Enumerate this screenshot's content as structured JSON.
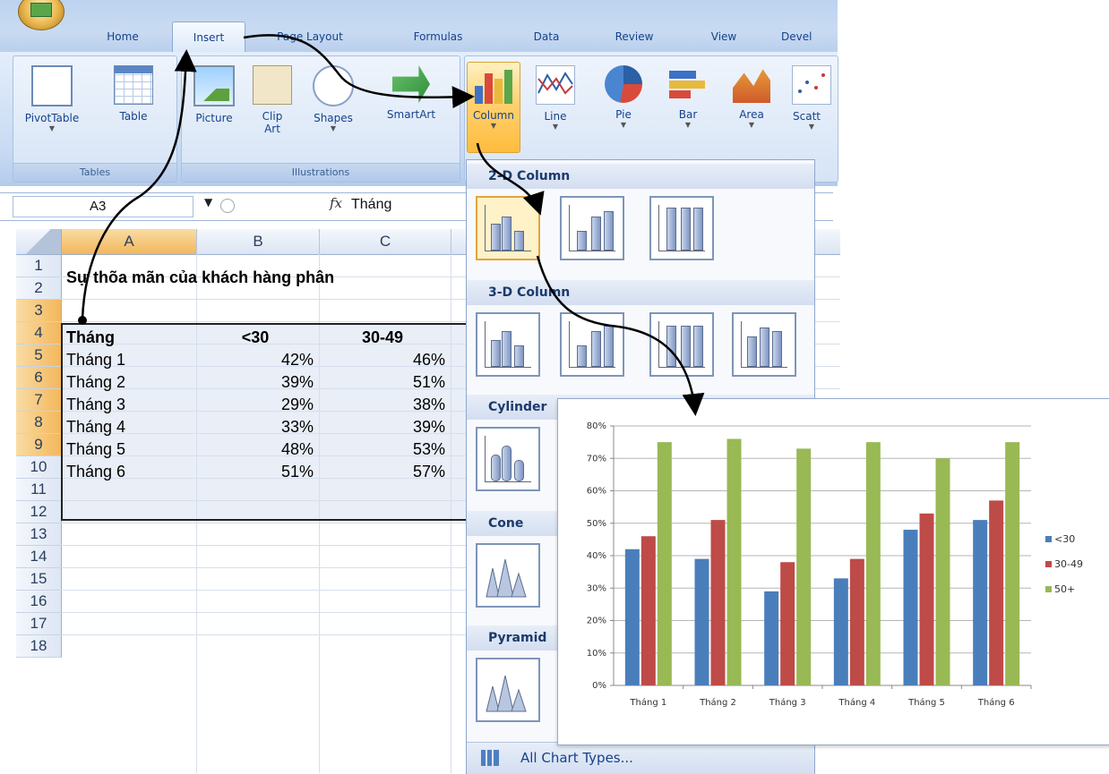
{
  "ribbon": {
    "tabs": [
      "Home",
      "Insert",
      "Page Layout",
      "Formulas",
      "Data",
      "Review",
      "View",
      "Devel"
    ],
    "active_tab": "Insert",
    "groups": {
      "tables": "Tables",
      "illustrations": "Illustrations"
    },
    "buttons": {
      "pivottable": "PivotTable",
      "table": "Table",
      "picture": "Picture",
      "clip_art": "Clip\nArt",
      "shapes": "Shapes",
      "smartart": "SmartArt",
      "column": "Column",
      "line": "Line",
      "pie": "Pie",
      "bar": "Bar",
      "area": "Area",
      "scatter": "Scatt"
    }
  },
  "formula_bar": {
    "name_box": "A3",
    "fx": "fx",
    "value": "Tháng"
  },
  "sheet": {
    "columns": [
      "A",
      "B",
      "C"
    ],
    "rows": [
      "1",
      "2",
      "3",
      "4",
      "5",
      "6",
      "7",
      "8",
      "9",
      "10",
      "11",
      "12",
      "13",
      "14",
      "15",
      "16",
      "17",
      "18"
    ],
    "title": "Sự thõa mãn của khách hàng phân",
    "header": [
      "Tháng",
      "<30",
      "30-49"
    ],
    "data": [
      [
        "Tháng 1",
        "42%",
        "46%"
      ],
      [
        "Tháng 2",
        "39%",
        "51%"
      ],
      [
        "Tháng 3",
        "29%",
        "38%"
      ],
      [
        "Tháng 4",
        "33%",
        "39%"
      ],
      [
        "Tháng 5",
        "48%",
        "53%"
      ],
      [
        "Tháng 6",
        "51%",
        "57%"
      ]
    ]
  },
  "gallery": {
    "sections": [
      "2-D Column",
      "3-D Column",
      "Cylinder",
      "Cone",
      "Pyramid"
    ],
    "footer": "All Chart Types..."
  },
  "chart_data": {
    "type": "bar",
    "categories": [
      "Tháng 1",
      "Tháng 2",
      "Tháng 3",
      "Tháng 4",
      "Tháng 5",
      "Tháng 6"
    ],
    "series": [
      {
        "name": "<30",
        "values": [
          42,
          39,
          29,
          33,
          48,
          51
        ],
        "color": "#4a7ebb"
      },
      {
        "name": "30-49",
        "values": [
          46,
          51,
          38,
          39,
          53,
          57
        ],
        "color": "#be4b48"
      },
      {
        "name": "50+",
        "values": [
          75,
          76,
          73,
          75,
          70,
          75
        ],
        "color": "#98b954"
      }
    ],
    "yticks": [
      "0%",
      "10%",
      "20%",
      "30%",
      "40%",
      "50%",
      "60%",
      "70%",
      "80%"
    ],
    "ylim": [
      0,
      80
    ],
    "grid": true,
    "legend": "right"
  },
  "colors": {
    "ribbon": "#c9dbf2",
    "selected_header": "#f3b75b",
    "gallery_highlight": "#ffd170"
  }
}
